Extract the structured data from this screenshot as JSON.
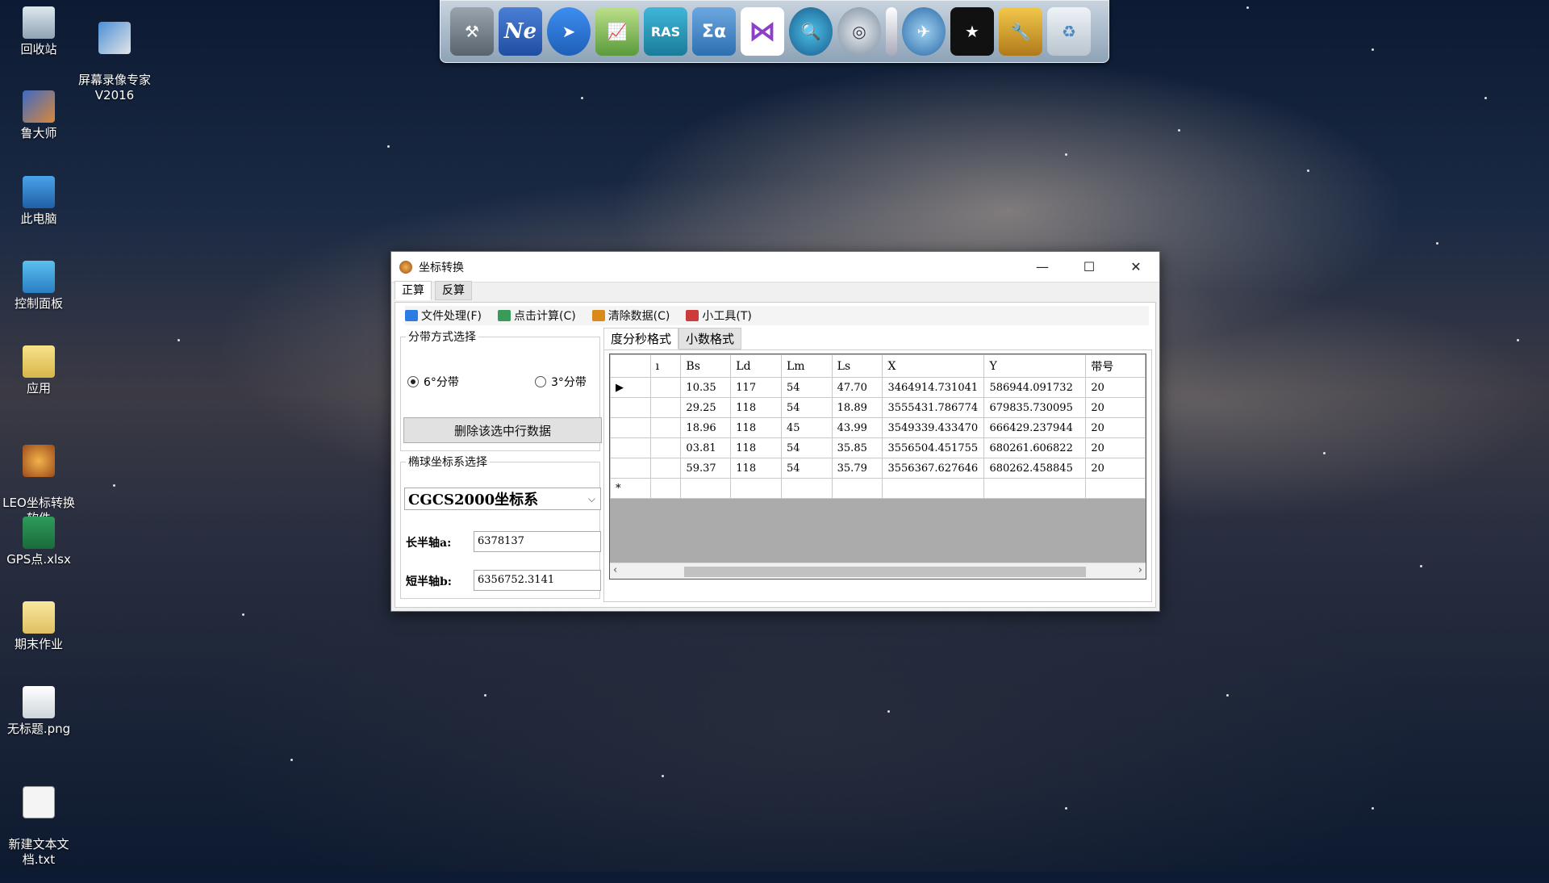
{
  "desktop": {
    "icons": [
      {
        "label": "回收站"
      },
      {
        "label": "屏幕录像专家\nV2016"
      },
      {
        "label": "鲁大师"
      },
      {
        "label": "此电脑"
      },
      {
        "label": "控制面板"
      },
      {
        "label": "应用"
      },
      {
        "label": "LEO坐标转换\n软件"
      },
      {
        "label": "GPS点.xlsx"
      },
      {
        "label": "期末作业"
      },
      {
        "label": "无标题.png"
      },
      {
        "label": "新建文本文\n档.txt"
      }
    ]
  },
  "dock": {
    "items": [
      {
        "icon": "tools-icon"
      },
      {
        "icon": "ne-icon",
        "label": "Ne"
      },
      {
        "icon": "compass-icon"
      },
      {
        "icon": "chart-icon"
      },
      {
        "icon": "ras-icon",
        "label": "RAS"
      },
      {
        "icon": "sigma-icon",
        "label": "Σα"
      },
      {
        "icon": "visual-studio-icon"
      },
      {
        "icon": "magnifier-globe-icon"
      },
      {
        "icon": "globe-icon"
      },
      {
        "icon": "divider-icon"
      },
      {
        "icon": "network-icon"
      },
      {
        "icon": "tshirt-icon"
      },
      {
        "icon": "wrench-icon"
      },
      {
        "icon": "recycle-icon"
      }
    ]
  },
  "window": {
    "title": "坐标转换",
    "menu_tabs": [
      "正算",
      "反算"
    ],
    "toolbar": {
      "file": "文件处理(F)",
      "calc": "点击计算(C)",
      "clear": "清除数据(C)",
      "tools": "小工具(T)"
    },
    "zone_group": {
      "legend": "分带方式选择",
      "option6": "6°分带",
      "option3": "3°分带",
      "selected": "6°分带"
    },
    "delete_button": "删除该选中行数据",
    "ellipsoid_group": {
      "legend": "椭球坐标系选择",
      "selected": "CGCS2000坐标系",
      "semi_major_label": "长半轴a:",
      "semi_major_value": "6378137",
      "semi_minor_label": "短半轴b:",
      "semi_minor_value": "6356752.3141"
    },
    "subtabs": [
      "度分秒格式",
      "小数格式"
    ],
    "table": {
      "columns": [
        "ı",
        "Bs",
        "Ld",
        "Lm",
        "Ls",
        "X",
        "Y",
        "带号"
      ],
      "rows": [
        [
          "",
          "10.35",
          "117",
          "54",
          "47.70",
          "3464914.731041",
          "586944.091732",
          "20"
        ],
        [
          "",
          "29.25",
          "118",
          "54",
          "18.89",
          "3555431.786774",
          "679835.730095",
          "20"
        ],
        [
          "",
          "18.96",
          "118",
          "45",
          "43.99",
          "3549339.433470",
          "666429.237944",
          "20"
        ],
        [
          "",
          "03.81",
          "118",
          "54",
          "35.85",
          "3556504.451755",
          "680261.606822",
          "20"
        ],
        [
          "",
          "59.37",
          "118",
          "54",
          "35.79",
          "3556367.627646",
          "680262.458845",
          "20"
        ]
      ],
      "new_row_marker": "*"
    }
  }
}
